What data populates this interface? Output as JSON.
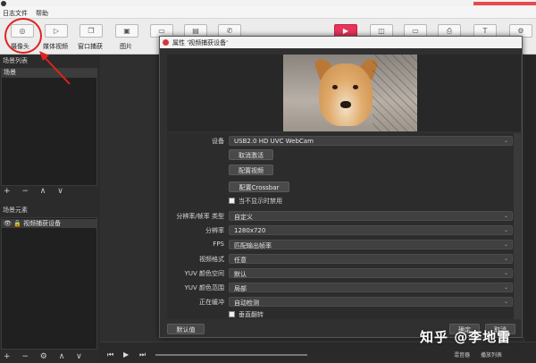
{
  "window": {
    "title": ""
  },
  "menu": {
    "items": [
      "日志文件",
      "帮助"
    ]
  },
  "toolbar": {
    "camera_label": "摄像头",
    "media_label": "媒体视频",
    "window_label": "窗口捕获",
    "image_label": "图片"
  },
  "scenes": {
    "title": "场景列表",
    "header": "场景",
    "controls": "+ − ∧ ∨"
  },
  "sources": {
    "title": "场景元素",
    "item": "视频捕获设备",
    "controls": "+ − ⚙ ∧ ∨"
  },
  "dialog": {
    "title": "属性 '视频捕获设备'",
    "device_label": "设备",
    "device_value": "USB2.0 HD UVC WebCam",
    "deactivate_btn": "取消激活",
    "config_video_btn": "配置视频",
    "config_crossbar_btn": "配置Crossbar",
    "hide_deactivate_label": "当不显示时禁用",
    "resolution_type_label": "分辨率/帧率 类型",
    "resolution_type_value": "自定义",
    "resolution_label": "分辨率",
    "resolution_value": "1280x720",
    "fps_label": "FPS",
    "fps_value": "匹配输出帧率",
    "video_format_label": "视频格式",
    "video_format_value": "任意",
    "yuv_space_label": "YUV 颜色空间",
    "yuv_space_value": "默认",
    "yuv_range_label": "YUV 颜色范围",
    "yuv_range_value": "局部",
    "buffering_label": "正在缓冲",
    "buffering_value": "自动检测",
    "flip_label": "垂直翻转",
    "defaults_btn": "默认值",
    "ok_btn": "确定",
    "cancel_btn": "取消"
  },
  "bottom": {
    "mixer": "混音器",
    "playlist": "播放列表"
  },
  "watermark": "知乎 @李地雷",
  "colors": {
    "annotation": "#e0231c",
    "live": "#e8335a"
  }
}
